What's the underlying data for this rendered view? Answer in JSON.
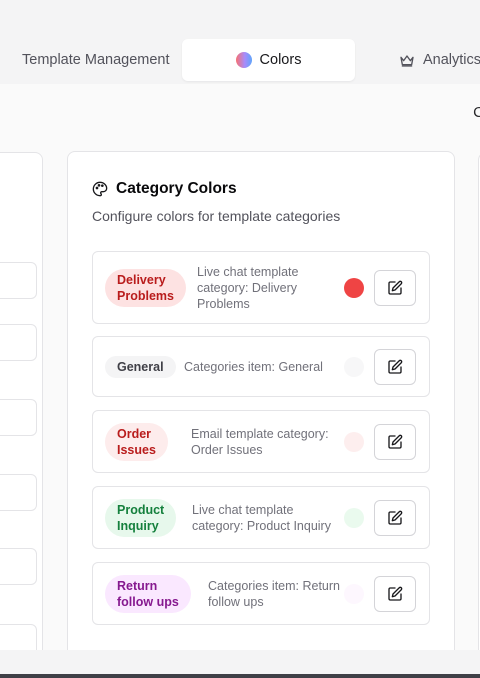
{
  "tabs": {
    "template_management": "Template Management",
    "colors": "Colors",
    "analytics": "Analytics"
  },
  "edge_text": "C",
  "category_colors": {
    "title": "Category Colors",
    "description": "Configure colors for template categories",
    "items": [
      {
        "badge_line1": "Delivery",
        "badge_line2": "Problems",
        "desc_line1": "Live chat template",
        "desc_line2": "category: Delivery",
        "desc_line3": "Problems",
        "badge_bg": "#fde2e2",
        "badge_fg": "#b91c1c",
        "swatch_color": "#ef4444"
      },
      {
        "badge_line1": "General",
        "desc_line1": "Categories item: General",
        "badge_bg": "#f4f4f5",
        "badge_fg": "#3f3f46",
        "swatch_color": "#f7f7f8"
      },
      {
        "badge_line1": "Order",
        "badge_line2": "Issues",
        "desc_line1": "Email template category:",
        "desc_line2": "Order Issues",
        "badge_bg": "#fdecec",
        "badge_fg": "#b91c1c",
        "swatch_color": "#fdeeee"
      },
      {
        "badge_line1": "Product",
        "badge_line2": "Inquiry",
        "desc_line1": "Live chat template",
        "desc_line2": "category: Product Inquiry",
        "badge_bg": "#e7f8ec",
        "badge_fg": "#15803d",
        "swatch_color": "#eafaee"
      },
      {
        "badge_line1": "Return",
        "badge_line2": "follow ups",
        "desc_line1": "Categories item: Return",
        "desc_line2": "follow ups",
        "badge_bg": "#fae8ff",
        "badge_fg": "#86198f",
        "swatch_color": "#fdf7fe"
      }
    ]
  }
}
